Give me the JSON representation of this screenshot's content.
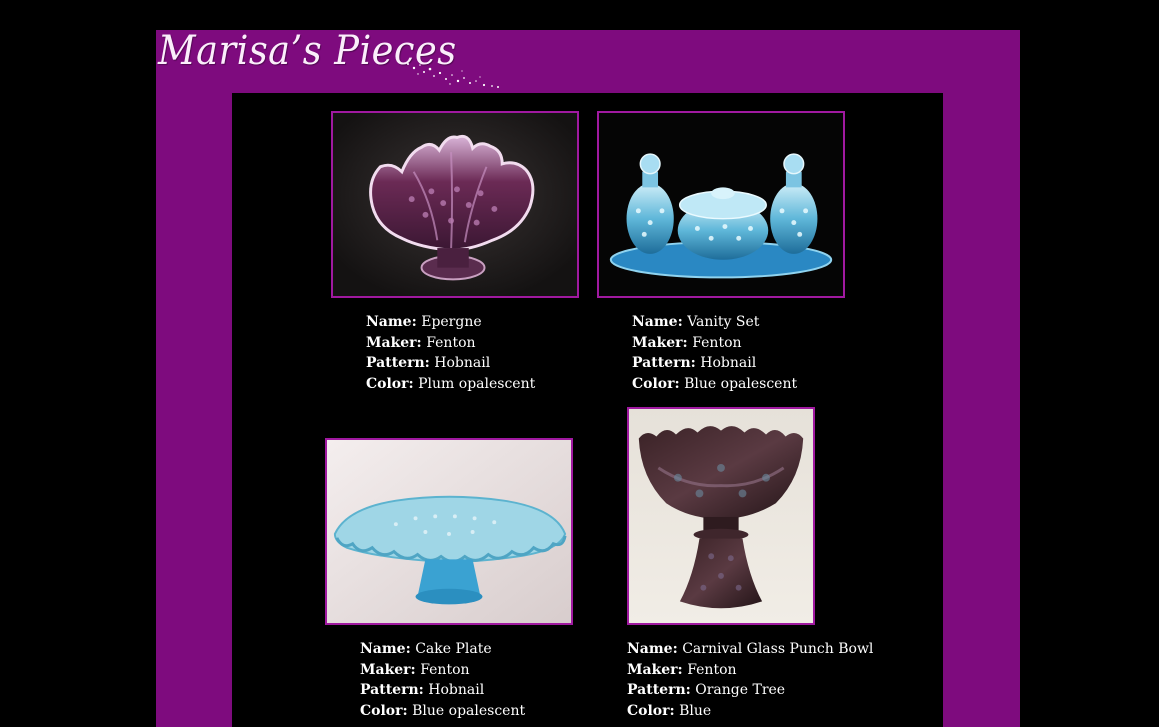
{
  "site": {
    "title": "Marisa’s Pieces"
  },
  "labels": {
    "name": "Name:",
    "maker": "Maker:",
    "pattern": "Pattern:",
    "color": "Color:"
  },
  "colors": {
    "frame": "#7e0b7e",
    "background": "#000000",
    "photo_border": "#a019a0",
    "text": "#ffffff"
  },
  "items": [
    {
      "name": "Epergne",
      "maker": "Fenton",
      "pattern": "Hobnail",
      "color": "Plum opalescent",
      "photo": "plum-epergne-photo"
    },
    {
      "name": "Vanity Set",
      "maker": "Fenton",
      "pattern": "Hobnail",
      "color": "Blue opalescent",
      "photo": "blue-vanity-set-photo"
    },
    {
      "name": "Cake Plate",
      "maker": "Fenton",
      "pattern": "Hobnail",
      "color": "Blue opalescent",
      "photo": "blue-cake-plate-photo"
    },
    {
      "name": "Carnival Glass Punch Bowl",
      "maker": "Fenton",
      "pattern": "Orange Tree",
      "color": "Blue",
      "photo": "carnival-punch-bowl-photo"
    }
  ]
}
